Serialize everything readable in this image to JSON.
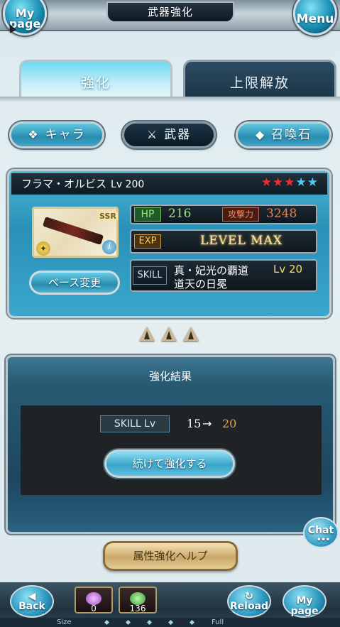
{
  "header": {
    "title": "武器強化",
    "mypage_label": "My page",
    "menu_label": "Menu"
  },
  "tabs": [
    {
      "label": "強化",
      "active": true
    },
    {
      "label": "上限解放",
      "active": false
    }
  ],
  "categories": [
    {
      "label": "キャラ",
      "icon": "chara-icon"
    },
    {
      "label": "武器",
      "icon": "weapon-icon",
      "active": true
    },
    {
      "label": "召喚石",
      "icon": "summon-stone-icon"
    }
  ],
  "weapon": {
    "name": "フラマ・オルビス",
    "level": "Lv 200",
    "rarity": "SSR",
    "stars": {
      "red": 3,
      "blue": 2
    },
    "hp_label": "HP",
    "hp": "216",
    "atk_label": "攻撃力",
    "atk": "3248",
    "exp_label": "EXP",
    "exp_value": "LEVEL MAX",
    "skill_label": "SKILL",
    "skill_name_line1": "真・妃光の覇道",
    "skill_name_line2": "道天の日冕",
    "skill_level": "Lv 20",
    "base_change_label": "ベース変更"
  },
  "result": {
    "title": "強化結果",
    "skill_lv_label": "SKILL Lv",
    "from": "15",
    "arrow": "→",
    "to": "20",
    "continue_label": "続けて強化する"
  },
  "chat_label": "Chat",
  "help_label": "属性強化ヘルプ",
  "footer": {
    "back_label": "Back",
    "reload_label": "Reload",
    "mypage_label": "My page",
    "item1_count": "0",
    "item2_count": "136",
    "size_label": "Size",
    "full_label": "Full"
  },
  "colors": {
    "accent_cyan": "#2a8db0",
    "atk_orange": "#f07d52",
    "hp_green": "#9fe07d",
    "level_to": "#f5a043"
  }
}
